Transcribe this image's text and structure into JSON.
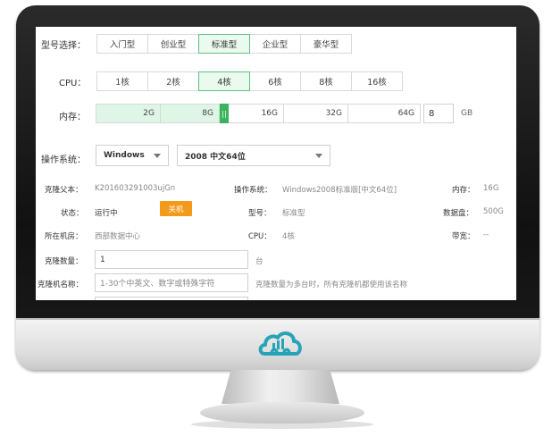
{
  "model": {
    "label": "型号选择：",
    "options": [
      "入门型",
      "创业型",
      "标准型",
      "企业型",
      "豪华型"
    ],
    "selected": "标准型"
  },
  "cpu": {
    "label": "CPU：",
    "options": [
      "1核",
      "2核",
      "4核",
      "6核",
      "8核",
      "16核"
    ],
    "selected": "4核"
  },
  "memory": {
    "label": "内存：",
    "ticks": [
      "2G",
      "8G",
      "16G",
      "32G",
      "64G"
    ],
    "value": "8",
    "unit": "GB"
  },
  "os": {
    "label": "操作系统：",
    "family": "Windows",
    "version": "2008 中文64位"
  },
  "info": {
    "parent_label": "克隆父本：",
    "parent_value": "K201603291003ujGn",
    "os_label": "操作系统：",
    "os_value": "Windows2008标准版[中文64位]",
    "mem_label": "内存：",
    "mem_value": "16G",
    "status_label": "状态：",
    "status_value": "运行中",
    "power_button": "关机",
    "type_label": "型号：",
    "type_value": "标准型",
    "disk_label": "数据盘：",
    "disk_value": "500G",
    "room_label": "所在机房：",
    "room_value": "西部数据中心",
    "cpu_label": "CPU：",
    "cpu_value": "4核",
    "bw_label": "带宽：",
    "bw_value": "--"
  },
  "clone": {
    "count_label": "克隆数量：",
    "count_value": "1",
    "count_unit": "台",
    "name_label": "克隆机名称：",
    "name_placeholder": "1-30个中英文、数字或特殊字符",
    "name_hint": "克隆数量为多台时，所有克隆机都使用该名称"
  },
  "colors": {
    "accent": "#3ab45c",
    "selected_bg": "#ebfaef",
    "button": "#f39a1b"
  }
}
